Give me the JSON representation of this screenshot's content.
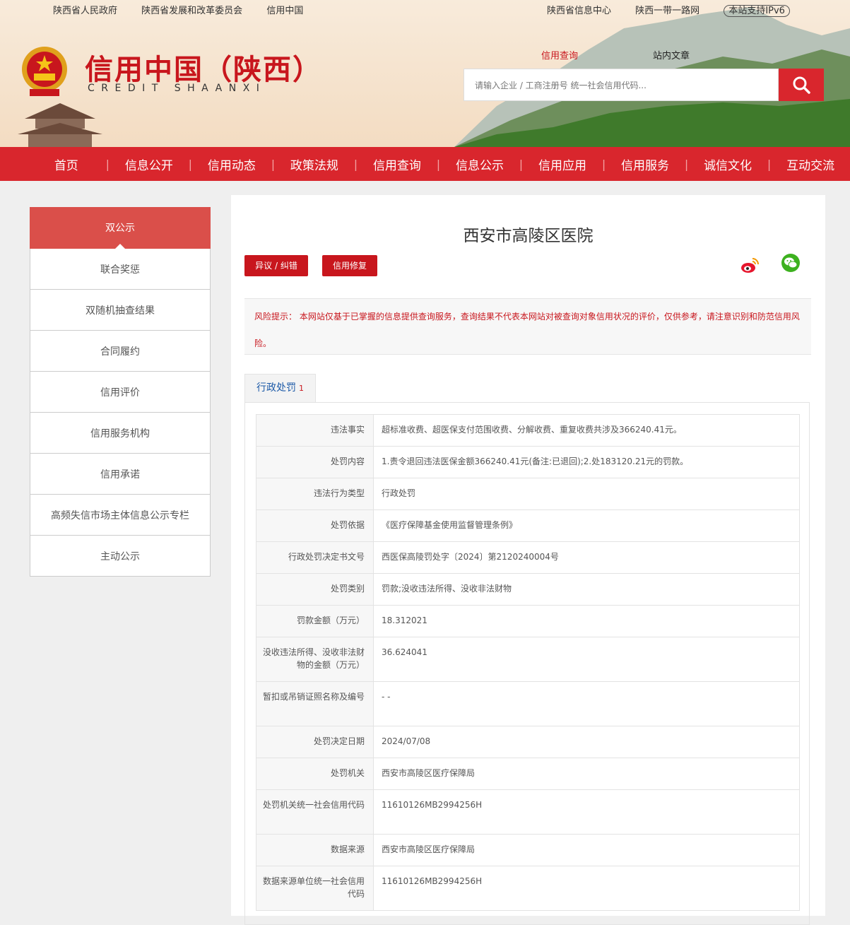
{
  "top_links_left": [
    "陕西省人民政府",
    "陕西省发展和改革委员会",
    "信用中国"
  ],
  "top_links_right": [
    "陕西省信息中心",
    "陕西一带一路网"
  ],
  "ipv6": "本站支持IPv6",
  "site_title_cn": "信用中国（陕西）",
  "site_title_en": "CREDIT SHAANXI",
  "search": {
    "tab_credit": "信用查询",
    "tab_site": "站内文章",
    "placeholder": "请输入企业 / 工商注册号 统一社会信用代码..."
  },
  "nav": [
    "首页",
    "信息公开",
    "信用动态",
    "政策法规",
    "信用查询",
    "信息公示",
    "信用应用",
    "信用服务",
    "诚信文化",
    "互动交流"
  ],
  "sidebar": [
    "双公示",
    "联合奖惩",
    "双随机抽查结果",
    "合同履约",
    "信用评价",
    "信用服务机构",
    "信用承诺",
    "高频失信市场主体信息公示专栏",
    "主动公示"
  ],
  "page_title": "西安市高陵区医院",
  "buttons": {
    "objection": "异议 / 纠错",
    "repair": "信用修复"
  },
  "risk_notice": "风险提示： 本网站仅基于已掌握的信息提供查询服务，查询结果不代表本网站对被查询对象信用状况的评价，仅供参考，请注意识别和防范信用风险。",
  "tab": {
    "label": "行政处罚",
    "count": "1"
  },
  "rows": [
    {
      "k": "违法事实",
      "v": "超标准收费、超医保支付范围收费、分解收费、重复收费共涉及366240.41元。"
    },
    {
      "k": "处罚内容",
      "v": "1.责令退回违法医保金额366240.41元(备注:已退回);2.处183120.21元的罚款。"
    },
    {
      "k": "违法行为类型",
      "v": "行政处罚"
    },
    {
      "k": "处罚依据",
      "v": "《医疗保障基金使用监督管理条例》"
    },
    {
      "k": "行政处罚决定书文号",
      "v": "西医保高陵罚处字〔2024〕第2120240004号"
    },
    {
      "k": "处罚类别",
      "v": "罚款;没收违法所得、没收非法财物"
    },
    {
      "k": "罚款金额（万元）",
      "v": "18.312021"
    },
    {
      "k": "没收违法所得、没收非法财物的金额（万元）",
      "v": "36.624041"
    },
    {
      "k": "暂扣或吊销证照名称及编号",
      "v": "- -"
    },
    {
      "k": "处罚决定日期",
      "v": "2024/07/08"
    },
    {
      "k": "处罚机关",
      "v": "西安市高陵区医疗保障局"
    },
    {
      "k": "处罚机关统一社会信用代码",
      "v": "11610126MB2994256H"
    },
    {
      "k": "数据来源",
      "v": "西安市高陵区医疗保障局"
    },
    {
      "k": "数据来源单位统一社会信用代码",
      "v": "11610126MB2994256H"
    }
  ]
}
